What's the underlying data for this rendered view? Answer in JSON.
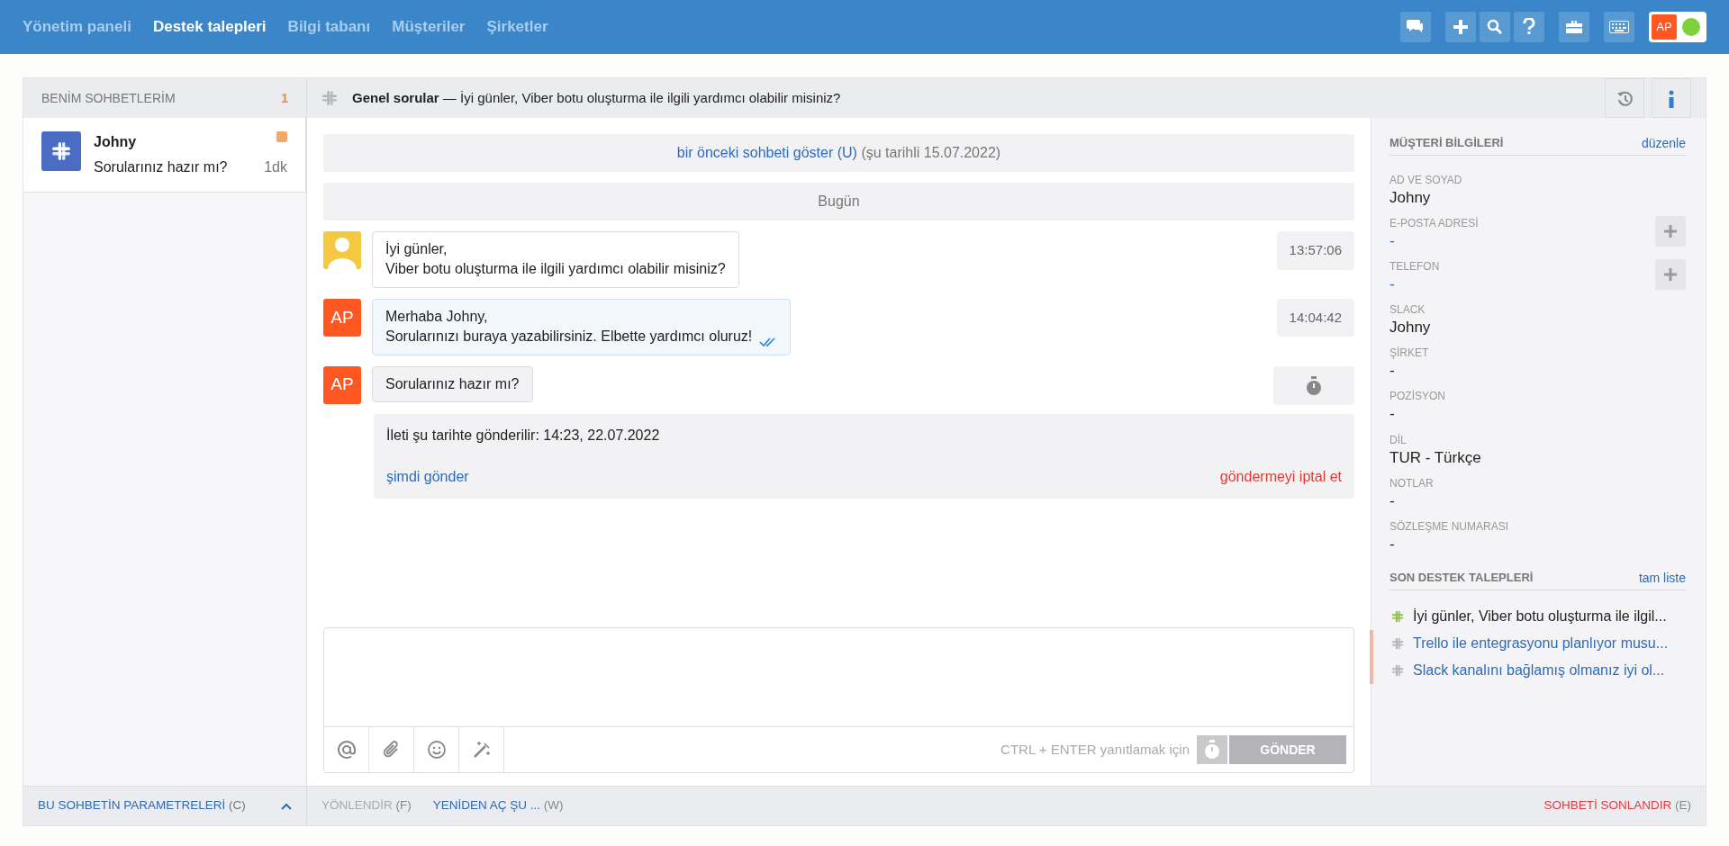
{
  "top_nav": [
    {
      "label": "Yönetim paneli",
      "selected": false
    },
    {
      "label": "Destek talepleri",
      "selected": true
    },
    {
      "label": "Bilgi tabanı",
      "selected": false
    },
    {
      "label": "Müşteriler",
      "selected": false
    },
    {
      "label": "Şirketler",
      "selected": false
    }
  ],
  "user": {
    "initials": "AP",
    "online": true
  },
  "chat_list": {
    "title": "BENİM SOHBETLERİM",
    "count": "1",
    "items": [
      {
        "name": "Johny",
        "preview": "Sorularınız hazır mı?",
        "time": "1dk",
        "color": "#f0a86b"
      }
    ]
  },
  "chat_header": {
    "channel": "Genel sorular",
    "separator": "—",
    "subject": "İyi günler, Viber botu oluşturma ile ilgili yardımcı olabilir misiniz?"
  },
  "history_bar": {
    "link": "bir önceki sohbeti göster (U)",
    "note": "(şu tarihli 15.07.2022)"
  },
  "day_label": "Bugün",
  "messages": [
    {
      "kind": "customer",
      "lines": [
        "İyi günler,",
        "Viber botu oluşturma ile ilgili yardımcı olabilir misiniz?"
      ],
      "time": "13:57:06"
    },
    {
      "kind": "agent",
      "avatar": "AP",
      "lines": [
        "Merhaba Johny,",
        "Sorularınızı buraya yazabilirsiniz. Elbette yardımcı oluruz!"
      ],
      "time": "14:04:42",
      "read": true
    },
    {
      "kind": "scheduled",
      "avatar": "AP",
      "lines": [
        "Sorularınız hazır mı?"
      ],
      "schedule": "İleti şu tarihte gönderilir: 14:23, 22.07.2022",
      "send_now": "şimdi gönder",
      "cancel": "göndermeyi iptal et"
    }
  ],
  "composer": {
    "hint": "CTRL + ENTER yanıtlamak için",
    "send": "GÖNDER",
    "send_disabled": true
  },
  "customer_info": {
    "title": "MÜŞTERİ BİLGİLERİ",
    "edit": "düzenle",
    "fields": [
      {
        "label": "AD VE SOYAD",
        "value": "Johny",
        "kind": "text"
      },
      {
        "label": "E-POSTA ADRESİ",
        "value": "-",
        "kind": "addable"
      },
      {
        "label": "TELEFON",
        "value": "-",
        "kind": "addable"
      },
      {
        "label": "SLACK",
        "value": "Johny",
        "kind": "text"
      },
      {
        "label": "ŞİRKET",
        "value": "-",
        "kind": "text"
      },
      {
        "label": "POZİSYON",
        "value": "-",
        "kind": "text"
      },
      {
        "label": "DİL",
        "value": "TUR - Türkçe",
        "kind": "text"
      },
      {
        "label": "NOTLAR",
        "value": "-",
        "kind": "text"
      },
      {
        "label": "SÖZLEŞME NUMARASI",
        "value": "-",
        "kind": "text"
      }
    ]
  },
  "recent_tickets": {
    "title": "SON DESTEK TALEPLERİ",
    "link": "tam liste",
    "items": [
      {
        "text": "İyi günler, Viber botu oluşturma ile ilgil...",
        "selected": true,
        "flagged": false
      },
      {
        "text": "Trello ile entegrasyonu planlıyor musu...",
        "selected": false,
        "flagged": true
      },
      {
        "text": "Slack kanalını bağlamış olmanız iyi ol...",
        "selected": false,
        "flagged": true
      }
    ]
  },
  "left_footer": {
    "label": "BU SOHBETİN PARAMETRELERİ",
    "key": "(C)"
  },
  "actions": [
    {
      "label": "YÖNLENDİR",
      "key": "(F)",
      "kind": "disabled"
    },
    {
      "label": "YENİDEN AÇ ŞU ...",
      "key": "(W)",
      "kind": "link"
    },
    {
      "label": "SOHBETİ SONLANDIR",
      "key": "(E)",
      "kind": "danger"
    }
  ]
}
